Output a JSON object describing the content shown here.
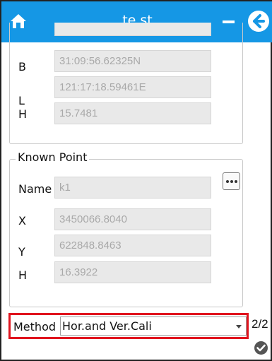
{
  "title": "te st",
  "top_fields": [
    {
      "label": "B",
      "value": "31:09:56.62325N"
    },
    {
      "label": "L",
      "value": "121:17:18.59461E"
    },
    {
      "label": "H",
      "value": "15.7481"
    }
  ],
  "known_point": {
    "legend": "Known Point",
    "fields": [
      {
        "label": "Name",
        "value": "k1"
      },
      {
        "label": "X",
        "value": "3450066.8040"
      },
      {
        "label": "Y",
        "value": "622848.8463"
      },
      {
        "label": "H",
        "value": "16.3922"
      }
    ]
  },
  "method": {
    "label": "Method",
    "value": "Hor.and Ver.Cali"
  },
  "page_indicator": "2/2",
  "icons": {
    "home": "home-icon",
    "minimize": "minus-icon",
    "back": "back-arrow-icon",
    "more": "more-dots-icon",
    "confirm": "checkmark-icon"
  },
  "colors": {
    "titlebar": "#1597e5",
    "highlight": "#e0141e"
  }
}
